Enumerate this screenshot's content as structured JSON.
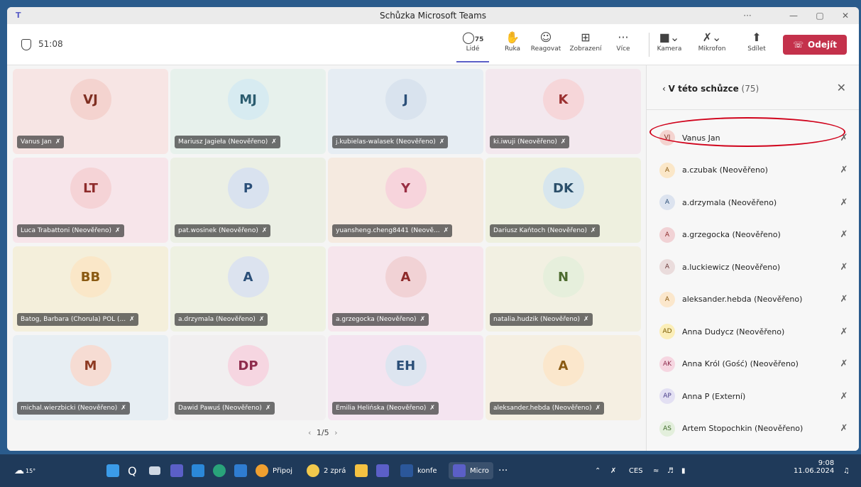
{
  "window": {
    "title": "Schůzka Microsoft Teams",
    "controls": {
      "more": "···",
      "min": "—",
      "max": "▢",
      "close": "✕"
    }
  },
  "toolbar": {
    "timer": "51:08",
    "people_count": "75",
    "people_label": "Lidé",
    "hand_label": "Ruka",
    "react_label": "Reagovat",
    "view_label": "Zobrazení",
    "more_label": "Více",
    "camera_label": "Kamera",
    "mic_label": "Mikrofon",
    "share_label": "Sdílet",
    "leave_label": "Odejít"
  },
  "tiles": [
    {
      "initials": "VJ",
      "name": "Vanus Jan",
      "bg": "#f7e5e4",
      "av": "#f4d3cf",
      "fg": "#7f2f22"
    },
    {
      "initials": "MJ",
      "name": "Mariusz Jagieła (Neověřeno)",
      "bg": "#e7f1ec",
      "av": "#d7ebf1",
      "fg": "#2b5c6f"
    },
    {
      "initials": "J",
      "name": "j.kubielas-walasek (Neověřeno)",
      "bg": "#e6edf3",
      "av": "#d9e3ee",
      "fg": "#2b4f78"
    },
    {
      "initials": "K",
      "name": "ki.iwuji (Neověřeno)",
      "bg": "#f3e8ee",
      "av": "#f6d6d9",
      "fg": "#9a2f2f"
    },
    {
      "initials": "LT",
      "name": "Luca Trabattoni (Neověřeno)",
      "bg": "#f7e5ea",
      "av": "#f5d3d6",
      "fg": "#8e2b2b"
    },
    {
      "initials": "P",
      "name": "pat.wosinek (Neověřeno)",
      "bg": "#ebefe4",
      "av": "#d9e2ef",
      "fg": "#2b4f78"
    },
    {
      "initials": "Y",
      "name": "yuansheng.cheng8441 (Neově...",
      "bg": "#f5eae0",
      "av": "#f7d4dc",
      "fg": "#9a2f44"
    },
    {
      "initials": "DK",
      "name": "Dariusz Kańtoch (Neověřeno)",
      "bg": "#eef0df",
      "av": "#d7e6ee",
      "fg": "#2b4f6a"
    },
    {
      "initials": "BB",
      "name": "Batog, Barbara (Chorula) POL (...",
      "bg": "#f4efdb",
      "av": "#fae7c8",
      "fg": "#8a5a12"
    },
    {
      "initials": "A",
      "name": "a.drzymala (Neověřeno)",
      "bg": "#eef1e2",
      "av": "#dce3ef",
      "fg": "#2b4f78"
    },
    {
      "initials": "A",
      "name": "a.grzegocka (Neověřeno)",
      "bg": "#f6e5ec",
      "av": "#f1d2d5",
      "fg": "#8e2b2b"
    },
    {
      "initials": "N",
      "name": "natalia.hudzik (Neověřeno)",
      "bg": "#f2f0e2",
      "av": "#e6efdc",
      "fg": "#4d6b2f"
    },
    {
      "initials": "M",
      "name": "michal.wierzbicki (Neověřeno)",
      "bg": "#e7eef3",
      "av": "#f6dcd3",
      "fg": "#8e3a22"
    },
    {
      "initials": "DP",
      "name": "Dawid Pawuś (Neověřeno)",
      "bg": "#f1eff0",
      "av": "#f6d6e1",
      "fg": "#8e2b4c"
    },
    {
      "initials": "EH",
      "name": "Emilia Helińska (Neověřeno)",
      "bg": "#f4e4f0",
      "av": "#dde5f0",
      "fg": "#2b4f78"
    },
    {
      "initials": "A",
      "name": "aleksander.hebda (Neověřeno)",
      "bg": "#f5efe2",
      "av": "#fbe7cc",
      "fg": "#8a5a12"
    }
  ],
  "pager": {
    "prev": "‹",
    "text": "1/5",
    "next": "›"
  },
  "panel": {
    "back": "‹",
    "title": "V této schůzce",
    "count": "(75)",
    "close": "✕",
    "people": [
      {
        "initials": "VJ",
        "name": "Vanus Jan",
        "bg": "#f4d3cf",
        "fg": "#7f2f22"
      },
      {
        "initials": "A",
        "name": "a.czubak (Neověřeno)",
        "bg": "#fbe7c8",
        "fg": "#8a5a12"
      },
      {
        "initials": "A",
        "name": "a.drzymala (Neověřeno)",
        "bg": "#dce3ef",
        "fg": "#2b4f78"
      },
      {
        "initials": "A",
        "name": "a.grzegocka (Neověřeno)",
        "bg": "#f1d2d5",
        "fg": "#8e2b2b"
      },
      {
        "initials": "A",
        "name": "a.luckiewicz (Neověřeno)",
        "bg": "#eadcdc",
        "fg": "#6b3a3a"
      },
      {
        "initials": "A",
        "name": "aleksander.hebda (Neověřeno)",
        "bg": "#fbe7cc",
        "fg": "#8a5a12"
      },
      {
        "initials": "AD",
        "name": "Anna Dudycz (Neověřeno)",
        "bg": "#fbeeb8",
        "fg": "#7a5a00"
      },
      {
        "initials": "AK",
        "name": "Anna Król (Gość) (Neověřeno)",
        "bg": "#f6d6e1",
        "fg": "#8e2b4c"
      },
      {
        "initials": "AP",
        "name": "Anna P (Externí)",
        "bg": "#e3e0f3",
        "fg": "#4a3f8a"
      },
      {
        "initials": "AS",
        "name": "Artem Stopochkin (Neověřeno)",
        "bg": "#e3efdc",
        "fg": "#3f6b2a"
      }
    ]
  },
  "taskbar": {
    "weather": "15°",
    "search": "Q",
    "item_pripoj": "Připoj",
    "item_zpra": "2 zprá",
    "item_konfe": "konfe",
    "item_micro": "Micro",
    "more": "···",
    "lang": "CES",
    "time": "9:08",
    "date": "11.06.2024"
  }
}
